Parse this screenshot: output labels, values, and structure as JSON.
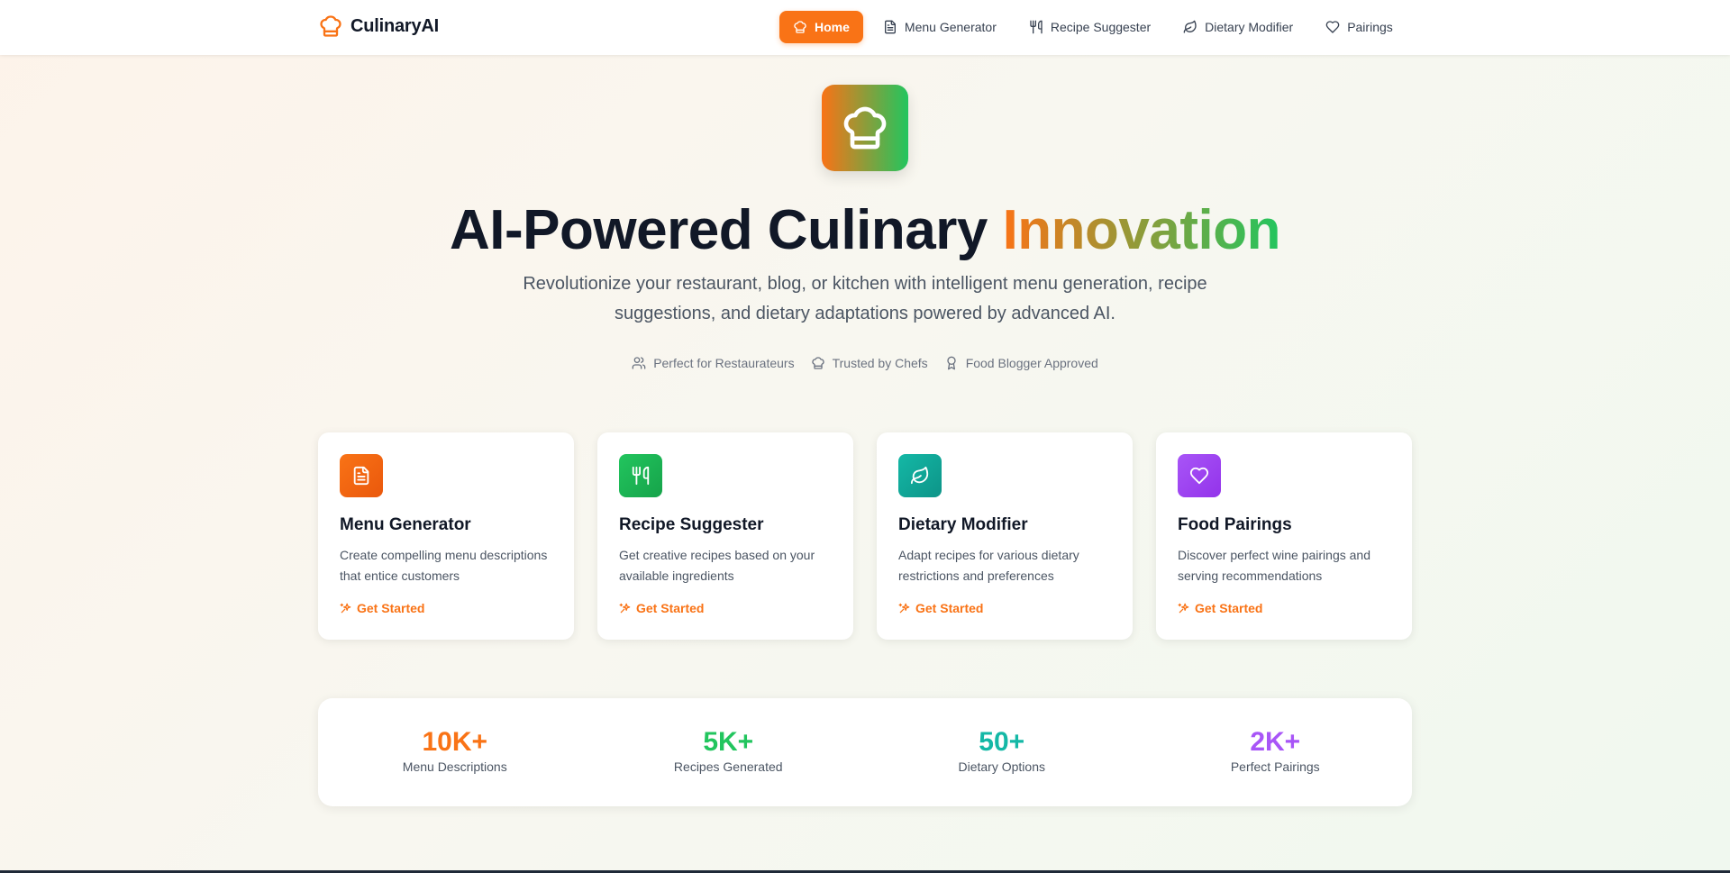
{
  "brand": {
    "name": "CulinaryAI",
    "icon": "chef-hat-icon",
    "accent": "#f97316"
  },
  "nav": {
    "items": [
      {
        "label": "Home",
        "icon": "chef-hat-icon",
        "active": true
      },
      {
        "label": "Menu Generator",
        "icon": "document-icon",
        "active": false
      },
      {
        "label": "Recipe Suggester",
        "icon": "utensils-icon",
        "active": false
      },
      {
        "label": "Dietary Modifier",
        "icon": "leaf-icon",
        "active": false
      },
      {
        "label": "Pairings",
        "icon": "heart-icon",
        "active": false
      }
    ]
  },
  "hero": {
    "title_main": "AI-Powered Culinary ",
    "title_accent": "Innovation",
    "subtitle": "Revolutionize your restaurant, blog, or kitchen with intelligent menu generation, recipe suggestions, and dietary adaptations powered by advanced AI.",
    "badges": [
      {
        "label": "Perfect for Restaurateurs",
        "icon": "users-icon"
      },
      {
        "label": "Trusted by Chefs",
        "icon": "chef-hat-icon"
      },
      {
        "label": "Food Blogger Approved",
        "icon": "award-icon"
      }
    ]
  },
  "features": [
    {
      "title": "Menu Generator",
      "description": "Create compelling menu descriptions that entice customers",
      "cta": "Get Started",
      "icon": "document-icon",
      "color_from": "#f97316",
      "color_to": "#ea580c"
    },
    {
      "title": "Recipe Suggester",
      "description": "Get creative recipes based on your available ingredients",
      "cta": "Get Started",
      "icon": "utensils-icon",
      "color_from": "#22c55e",
      "color_to": "#16a34a"
    },
    {
      "title": "Dietary Modifier",
      "description": "Adapt recipes for various dietary restrictions and preferences",
      "cta": "Get Started",
      "icon": "leaf-icon",
      "color_from": "#14b8a6",
      "color_to": "#0d9488"
    },
    {
      "title": "Food Pairings",
      "description": "Discover perfect wine pairings and serving recommendations",
      "cta": "Get Started",
      "icon": "heart-icon",
      "color_from": "#a855f7",
      "color_to": "#9333ea"
    }
  ],
  "stats": [
    {
      "value": "10K+",
      "label": "Menu Descriptions",
      "color": "#f97316"
    },
    {
      "value": "5K+",
      "label": "Recipes Generated",
      "color": "#22c55e"
    },
    {
      "value": "50+",
      "label": "Dietary Options",
      "color": "#14b8a6"
    },
    {
      "value": "2K+",
      "label": "Perfect Pairings",
      "color": "#a855f7"
    }
  ]
}
